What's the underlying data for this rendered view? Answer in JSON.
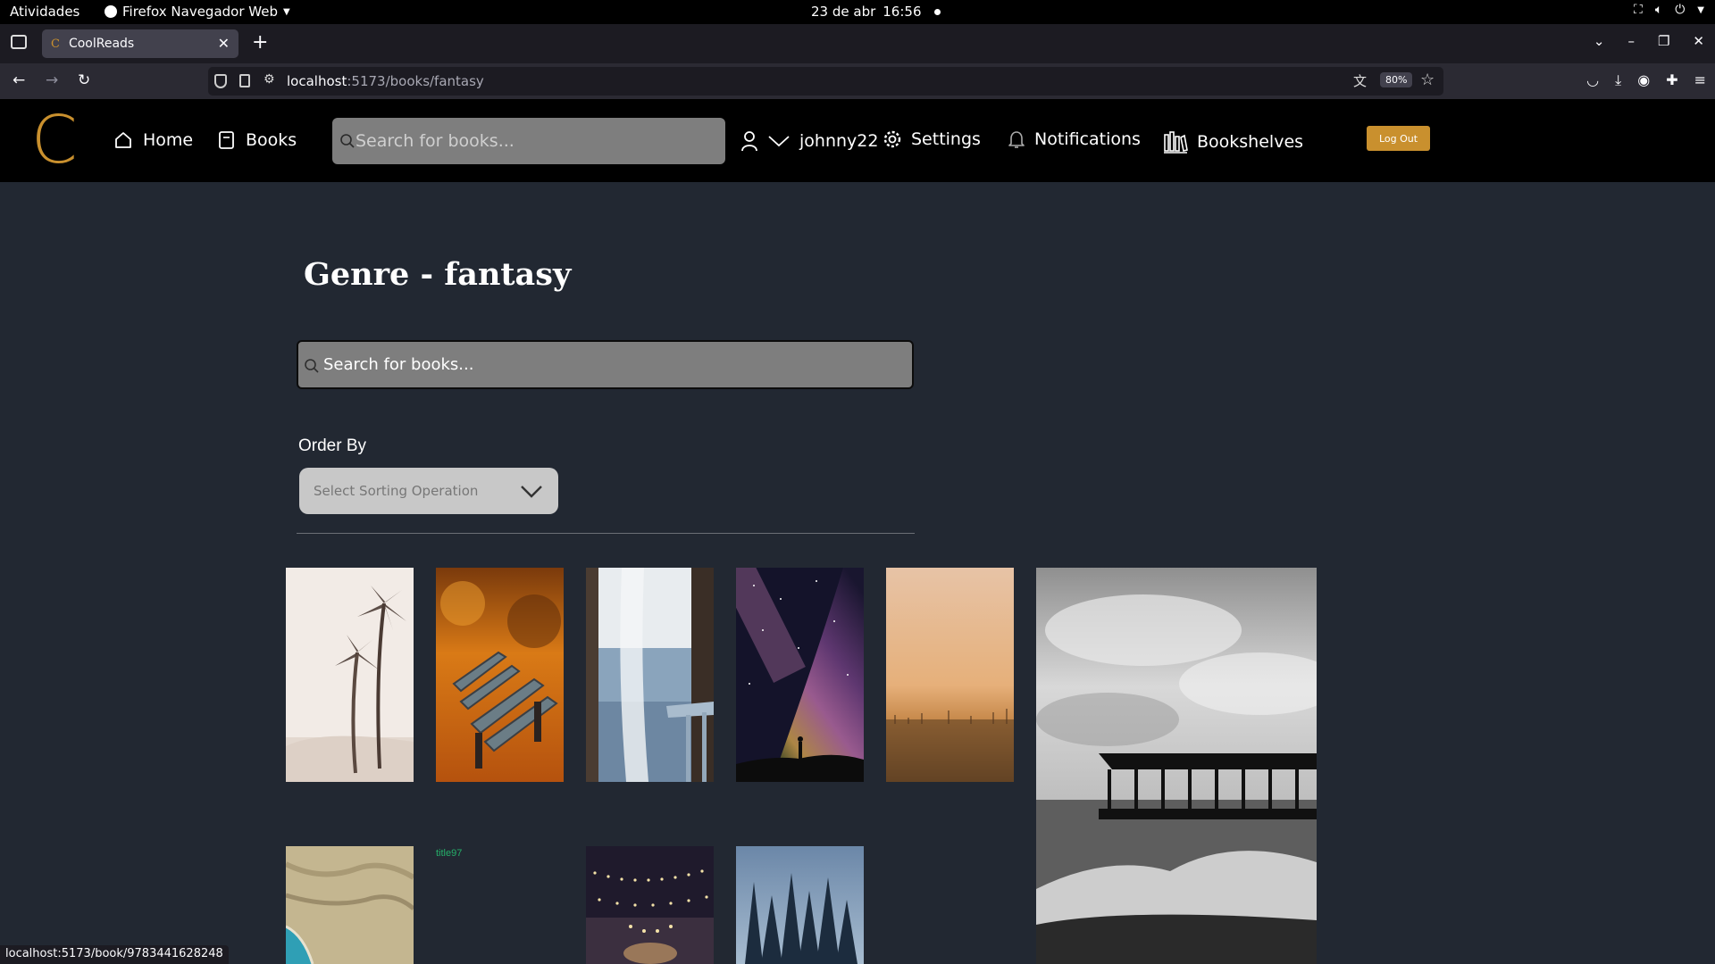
{
  "system_bar": {
    "activities": "Atividades",
    "app_name": "Firefox Navegador Web",
    "date": "23 de abr",
    "time": "16:56"
  },
  "browser": {
    "tab_title": "CoolReads",
    "url_host": "localhost",
    "url_path": ":5173/books/fantasy",
    "zoom": "80%",
    "status_url": "localhost:5173/book/9783441628248"
  },
  "header": {
    "logo_letter": "C",
    "nav": {
      "home": "Home",
      "books": "Books",
      "username": "johnny22",
      "settings": "Settings",
      "notifications": "Notifications",
      "bookshelves": "Bookshelves"
    },
    "search_placeholder": "Search for books...",
    "logout": "Log Out"
  },
  "main": {
    "title": "Genre - fantasy",
    "search_placeholder": "Search for books...",
    "order_by_label": "Order By",
    "sort_placeholder": "Select Sorting Operation"
  },
  "books": [
    {
      "id": "palm",
      "type": "image",
      "colors": [
        "#f3ede8",
        "#e9e0da",
        "#d8cbc2"
      ]
    },
    {
      "id": "autumn-bench",
      "type": "image",
      "colors": [
        "#d77a14",
        "#9b3e0c",
        "#5a2a10"
      ]
    },
    {
      "id": "window",
      "type": "image",
      "colors": [
        "#5a4a3c",
        "#9db4c8",
        "#d8dfe6"
      ]
    },
    {
      "id": "galaxy",
      "type": "image",
      "colors": [
        "#1a1530",
        "#a85ea5",
        "#e0b26b"
      ]
    },
    {
      "id": "sunset-field",
      "type": "image",
      "colors": [
        "#d9a87f",
        "#b9824f",
        "#5c4026"
      ]
    },
    {
      "id": "pier",
      "type": "image",
      "colors": [
        "#cfcfcf",
        "#8e8e8e",
        "#2a2a2a"
      ]
    },
    {
      "id": "coast-aerial",
      "type": "image",
      "colors": [
        "#c2b48e",
        "#8d8467",
        "#2b8aa0"
      ]
    },
    {
      "id": "title97",
      "type": "text",
      "title": "title97"
    },
    {
      "id": "lights",
      "type": "image",
      "colors": [
        "#1f1a2c",
        "#3d2f45",
        "#d9c18a"
      ]
    },
    {
      "id": "forest",
      "type": "image",
      "colors": [
        "#7792b1",
        "#3d5a78",
        "#1d2f44"
      ]
    }
  ]
}
